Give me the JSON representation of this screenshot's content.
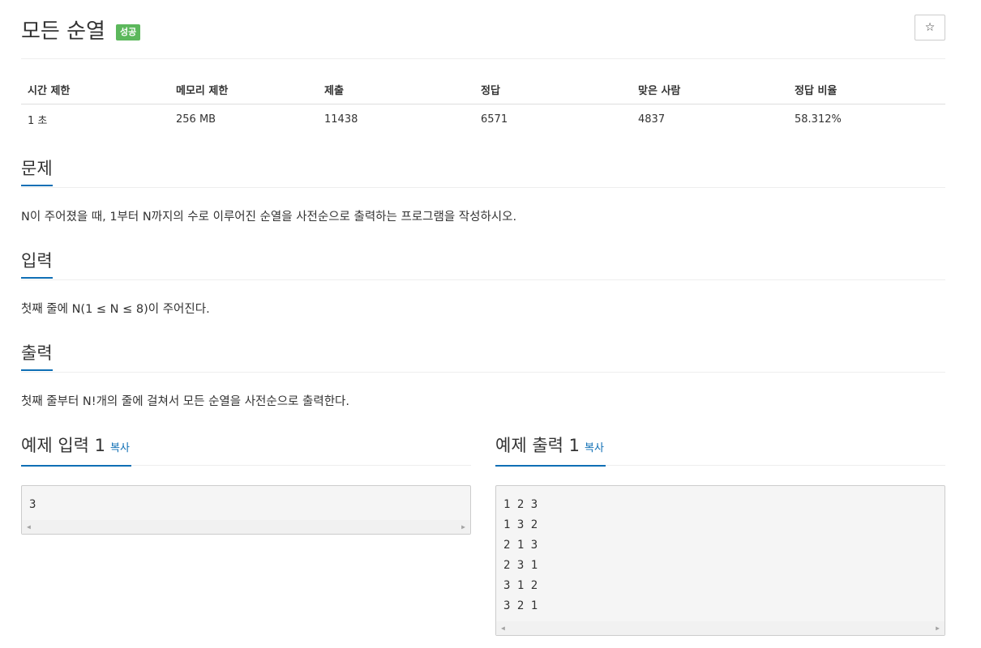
{
  "problem": {
    "title": "모든 순열",
    "status_badge": "성공",
    "star_icon": "☆"
  },
  "stats": {
    "headers": [
      "시간 제한",
      "메모리 제한",
      "제출",
      "정답",
      "맞은 사람",
      "정답 비율"
    ],
    "values": [
      "1 초",
      "256 MB",
      "11438",
      "6571",
      "4837",
      "58.312%"
    ]
  },
  "sections": {
    "description": {
      "title": "문제",
      "text": "N이 주어졌을 때, 1부터 N까지의 수로 이루어진 순열을 사전순으로 출력하는 프로그램을 작성하시오."
    },
    "input": {
      "title": "입력",
      "text": "첫째 줄에 N(1 ≤ N ≤ 8)이 주어진다."
    },
    "output": {
      "title": "출력",
      "text": "첫째 줄부터 N!개의 줄에 걸쳐서 모든 순열을 사전순으로 출력한다."
    }
  },
  "samples": {
    "input": {
      "title": "예제 입력 1",
      "copy_label": "복사",
      "lines": [
        "3"
      ]
    },
    "output": {
      "title": "예제 출력 1",
      "copy_label": "복사",
      "lines": [
        "1 2 3",
        "1 3 2",
        "2 1 3",
        "2 3 1",
        "3 1 2",
        "3 2 1"
      ]
    }
  },
  "colors": {
    "success_badge": "#5cb85c",
    "accent": "#0f6fb5"
  },
  "icons": [
    "star-icon",
    "scroll-left-arrow-icon",
    "scroll-right-arrow-icon"
  ]
}
